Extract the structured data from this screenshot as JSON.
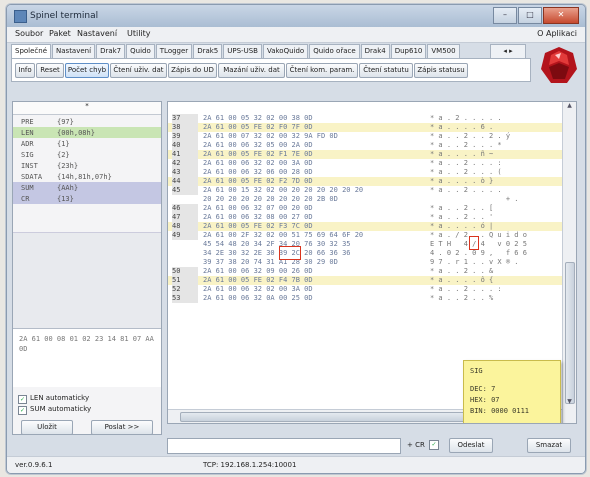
{
  "window": {
    "title": "Spinel terminal"
  },
  "menu": [
    "Soubor",
    "Paket",
    "Nastavení",
    "Utility"
  ],
  "menu_right": "O Aplikaci",
  "tabs": [
    "Společné",
    "Nastavení",
    "Drak7",
    "Quido",
    "TLogger",
    "Drak5",
    "UPS-USB",
    "VakoQuido",
    "Quido ořace",
    "Drak4",
    "Dup610",
    "VM500"
  ],
  "tab_arrows": "◂ ▸",
  "toolbar": [
    "Info",
    "Reset",
    "Počet chyb",
    "Čtení uživ. dat",
    "Zápis do UD",
    "Mazání uživ. dat",
    "Čtení kom. param.",
    "Čtení statutu",
    "Zápis statusu"
  ],
  "fields": {
    "header": "*",
    "rows": [
      {
        "name": "PRE",
        "value": "{97}",
        "hl": ""
      },
      {
        "name": "LEN",
        "value": "{00h,08h}",
        "hl": "g"
      },
      {
        "name": "ADR",
        "value": "{1}",
        "hl": ""
      },
      {
        "name": "SIG",
        "value": "{2}",
        "hl": ""
      },
      {
        "name": "INST",
        "value": "{23h}",
        "hl": ""
      },
      {
        "name": "SDATA",
        "value": "{14h,81h,07h}",
        "hl": ""
      },
      {
        "name": "SUM",
        "value": "{AAh}",
        "hl": "b"
      },
      {
        "name": "CR",
        "value": "{13}",
        "hl": "b"
      }
    ]
  },
  "packet_hex": "2A 61 00 08 01 02 23 14 81 07 AA 0D",
  "checkboxes": [
    {
      "label": "LEN automaticky",
      "checked": true
    },
    {
      "label": "SUM automaticky",
      "checked": true
    }
  ],
  "left_buttons": {
    "save": "Uložit",
    "send": "Poslat >>"
  },
  "log_rows": [
    {
      "n": "37",
      "hex": "2A 61 00 05 32 02 00 38 0D",
      "ascii": "* a . 2 . . . . .",
      "y": false
    },
    {
      "n": "38",
      "hex": "2A 61 00 05 FE 02 F0 7F 0D",
      "ascii": "* a . . . . 6 .",
      "y": true
    },
    {
      "n": "39",
      "hex": "2A 61 00 07 32 02 00 32 9A FD 0D",
      "ascii": "* a . . 2 . . 2 . ý",
      "y": false
    },
    {
      "n": "40",
      "hex": "2A 61 00 06 32 05 00 2A 0D",
      "ascii": "* a . . 2 . . . *",
      "y": false
    },
    {
      "n": "41",
      "hex": "2A 61 00 05 FE 02 F1 7E 0D",
      "ascii": "* a . . . . ñ ~",
      "y": true
    },
    {
      "n": "42",
      "hex": "2A 61 00 06 32 02 00 3A 0D",
      "ascii": "* a . . 2 . . . :",
      "y": false
    },
    {
      "n": "43",
      "hex": "2A 61 00 06 32 06 00 28 0D",
      "ascii": "* a . . 2 . . . (",
      "y": false
    },
    {
      "n": "44",
      "hex": "2A 61 00 05 FE 02 F2 7D 0D",
      "ascii": "* a . . . . ò }",
      "y": true
    },
    {
      "n": "45",
      "hex": "2A 61 00 15 32 02 00 20 20 20 20 20 20",
      "ascii": "* a . . 2 . . . .",
      "y": false
    },
    {
      "n": "",
      "hex": "20 20 20 20 20 20 20 20 20 2B 0D",
      "ascii": "                  + .",
      "y": false
    },
    {
      "n": "46",
      "hex": "2A 61 00 06 32 07 00 20 0D",
      "ascii": "* a . . 2 . . [",
      "y": false
    },
    {
      "n": "47",
      "hex": "2A 61 00 06 32 08 00 27 0D",
      "ascii": "* a . . 2 . . '",
      "y": false
    },
    {
      "n": "48",
      "hex": "2A 61 00 05 FE 02 F3 7C 0D",
      "ascii": "* a . . . . ó |",
      "y": true
    },
    {
      "n": "49",
      "hex": "2A 61 00 2F 32 02 00 51 75 69 64 6F 20",
      "ascii": "* a . / 2 . . Q u i d o",
      "y": false
    },
    {
      "n": "",
      "hex": "45 54 48 20 34 2F 34 20 76 30 32 35",
      "ascii": "E T H   4 / 4   v 0 2 5",
      "y": false
    },
    {
      "n": "",
      "hex": "34 2E 30 32 2E 30 39 2C 20 66 36 36",
      "ascii": "4 . 0 2 . 0 9 ,   f 6 6",
      "y": false
    },
    {
      "n": "",
      "hex": "39 37 38 20 74 31 A1 28 30 29 0D",
      "ascii": "9 7 . r 1 . . v X ® .",
      "y": false
    },
    {
      "n": "50",
      "hex": "2A 61 00 06 32 09 00 26 0D",
      "ascii": "* a . . 2 . . &",
      "y": false
    },
    {
      "n": "51",
      "hex": "2A 61 00 05 FE 02 F4 7B 0D",
      "ascii": "* a . . . . ô {",
      "y": true
    },
    {
      "n": "52",
      "hex": "2A 61 00 06 32 02 00 3A 0D",
      "ascii": "* a . . 2 . . . :",
      "y": false
    },
    {
      "n": "53",
      "hex": "2A 61 00 06 32 0A 00 25 0D",
      "ascii": "* a . . 2 . . %",
      "y": false
    }
  ],
  "tooltip": {
    "title": "SIG",
    "dec": "DEC: 7",
    "hex": "HEX: 07",
    "bin": "BIN: 0000 0111"
  },
  "bottom": {
    "cr_label": "+ CR",
    "send": "Odeslat",
    "clear": "Smazat"
  },
  "status": {
    "version": "ver.0.9.6.1",
    "connection": "TCP: 192.168.1.254:10001"
  }
}
